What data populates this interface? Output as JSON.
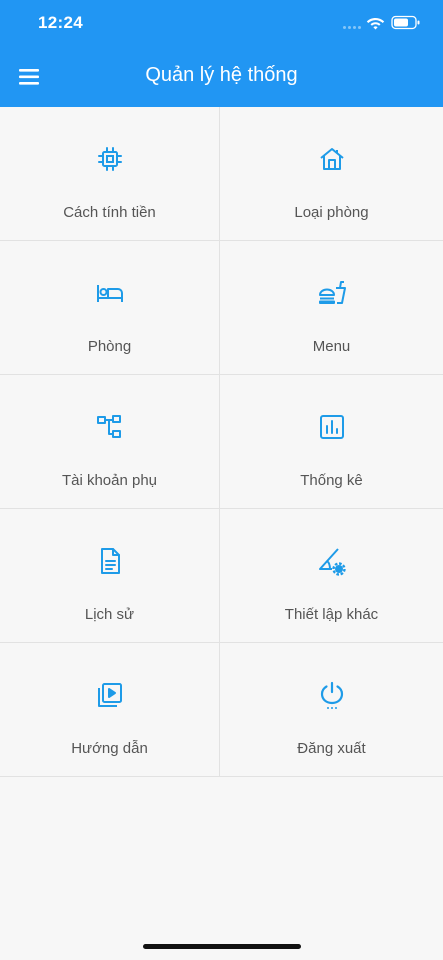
{
  "status_bar": {
    "time": "12:24"
  },
  "header": {
    "title": "Quản lý hệ thống",
    "menu_icon": "hamburger-menu-icon"
  },
  "colors": {
    "primary": "#2196f3",
    "icon": "#1e9be8",
    "background": "#f7f7f7",
    "label": "#555555"
  },
  "menu_items": [
    {
      "label": "Cách tính tiền",
      "icon": "chip-icon"
    },
    {
      "label": "Loại phòng",
      "icon": "home-icon"
    },
    {
      "label": "Phòng",
      "icon": "bed-icon"
    },
    {
      "label": "Menu",
      "icon": "fastfood-icon"
    },
    {
      "label": "Tài khoản phụ",
      "icon": "account-tree-icon"
    },
    {
      "label": "Thống kê",
      "icon": "bar-chart-icon"
    },
    {
      "label": "Lịch sử",
      "icon": "document-icon"
    },
    {
      "label": "Thiết lập khác",
      "icon": "settings-angle-icon"
    },
    {
      "label": "Hướng dẫn",
      "icon": "video-library-icon"
    },
    {
      "label": "Đăng xuất",
      "icon": "power-icon"
    }
  ]
}
